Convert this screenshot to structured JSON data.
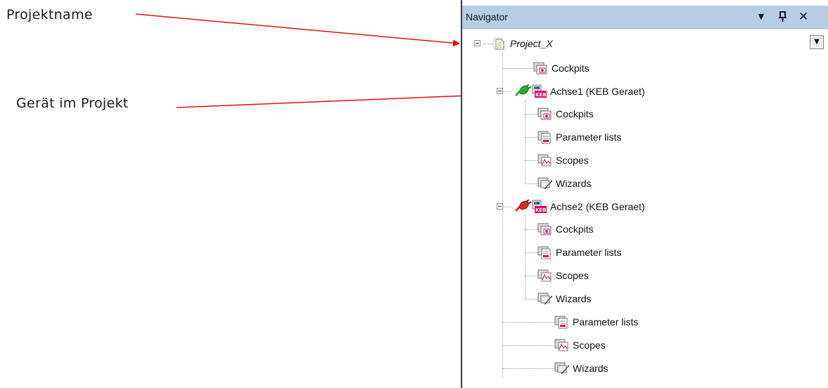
{
  "annotations": {
    "project_name": "Projektname",
    "device_in_project": "Gerät im Projekt"
  },
  "navigator": {
    "title": "Navigator",
    "menu_glyph": "▼",
    "pin_glyph": "ꟼ",
    "close_glyph": "✕",
    "dropdown_glyph": "▼",
    "project": {
      "label": "Project_X",
      "children": {
        "cockpits": "Cockpits",
        "axis1": {
          "label": "Achse1 (KEB Geraet)",
          "status": "connected",
          "status_color": "#2ea82e",
          "cockpits": "Cockpits",
          "parameter_lists": "Parameter lists",
          "scopes": "Scopes",
          "wizards": "Wizards"
        },
        "axis2": {
          "label": "Achse2 (KEB Geraet)",
          "status": "disconnected",
          "status_color": "#d22b2b",
          "cockpits": "Cockpits",
          "parameter_lists": "Parameter lists",
          "scopes": "Scopes",
          "wizards": "Wizards"
        },
        "parameter_lists": "Parameter lists",
        "scopes": "Scopes",
        "wizards": "Wizards"
      }
    }
  },
  "colors": {
    "titlebar": "#b7cde3",
    "arrow": "#e01010",
    "keb_badge": "#e0006a"
  },
  "icon_names": [
    "project-file-icon",
    "cockpit-icon",
    "device-keb-icon",
    "connector-plug-icon",
    "parameter-list-icon",
    "scope-icon",
    "wizard-icon"
  ]
}
